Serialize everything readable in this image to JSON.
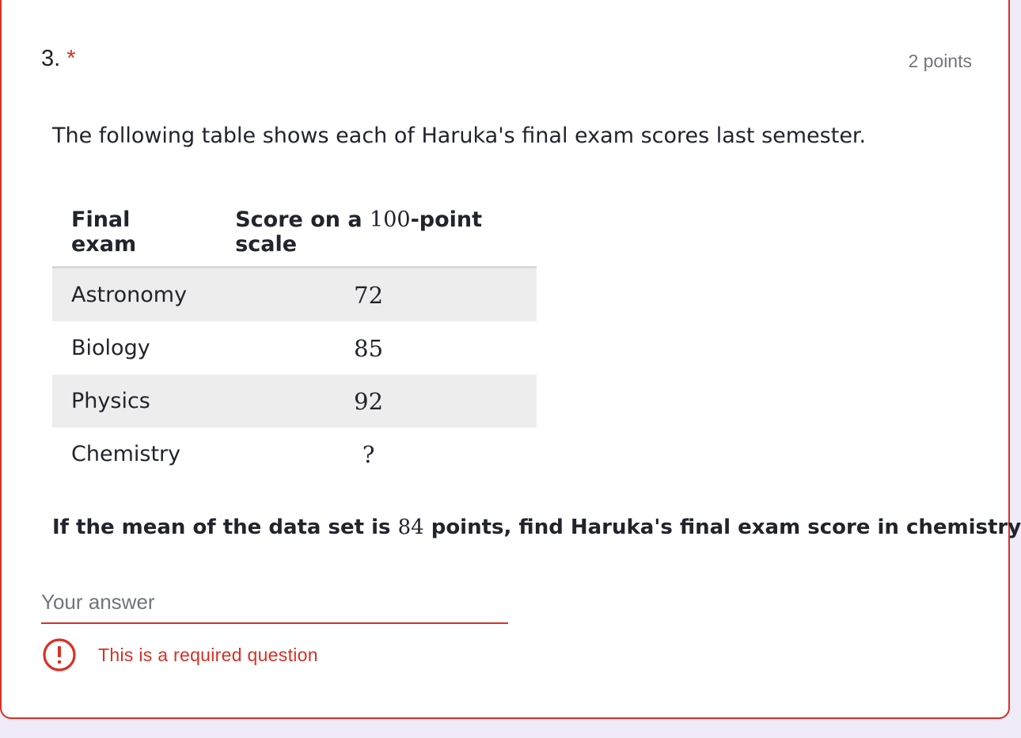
{
  "question": {
    "number": "3.",
    "required_marker": "*",
    "points": "2 points",
    "intro": "The following table shows each of Haruka's final exam scores last semester.",
    "table": {
      "headers": {
        "col1": "Final exam",
        "col2_prefix": "Score on a ",
        "col2_number": "100",
        "col2_suffix": "-point scale"
      },
      "rows": [
        {
          "subject": "Astronomy",
          "score": "72"
        },
        {
          "subject": "Biology",
          "score": "85"
        },
        {
          "subject": "Physics",
          "score": "92"
        },
        {
          "subject": "Chemistry",
          "score": "?"
        }
      ]
    },
    "prompt_prefix": "If the mean of the data set is ",
    "prompt_number": "84",
    "prompt_suffix": " points, find Haruka's final exam score in chemistry."
  },
  "answer": {
    "placeholder": "Your answer",
    "value": ""
  },
  "error": {
    "icon": "error-exclamation-circle-icon",
    "message": "This is a required question"
  },
  "colors": {
    "error_red": "#d93025",
    "background": "#f0ebf8",
    "row_shade": "#ededed"
  }
}
